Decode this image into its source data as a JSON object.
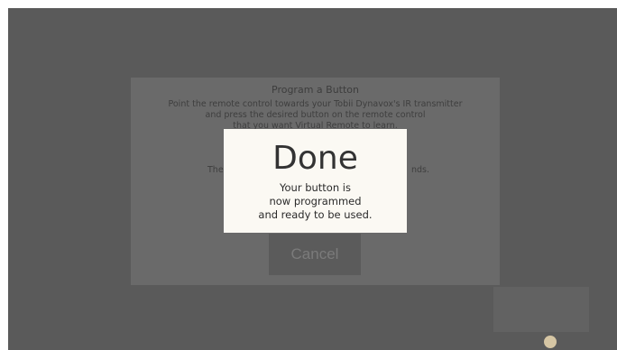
{
  "program_dialog": {
    "title": "Program a Button",
    "instruction_lines": [
      "Point the remote control towards your Tobii Dynavox's IR transmitter",
      "and press the desired button on the remote control",
      "that you want Virtual Remote to learn."
    ],
    "status_left_fragment": "The",
    "status_right_fragment": "nds.",
    "cancel_label": "Cancel"
  },
  "done_modal": {
    "title": "Done",
    "message_lines": [
      "Your button is",
      "now programmed",
      "and ready to be used."
    ]
  },
  "colors": {
    "overlay": "#5a5a5a",
    "modal_bg": "#fbf9f3",
    "accent_circle": "#d6c6a4"
  }
}
